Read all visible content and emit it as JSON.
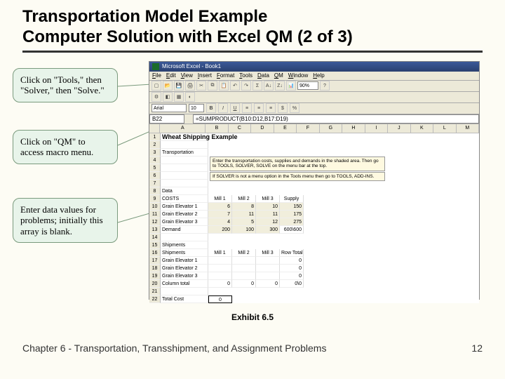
{
  "slide": {
    "title_line1": "Transportation Model Example",
    "title_line2": "Computer Solution with Excel QM (2 of 3)",
    "caption": "Exhibit 6.5",
    "footer_left": "Chapter 6 - Transportation, Transshipment, and Assignment Problems",
    "footer_right": "12"
  },
  "callouts": [
    {
      "text": "Click on \"Tools,\" then \"Solver,\" then \"Solve.\""
    },
    {
      "text": "Click on \"QM\" to access macro menu."
    },
    {
      "text": "Enter data values for problems; initially this array is blank."
    }
  ],
  "excel": {
    "titlebar": "Microsoft Excel - Book1",
    "menus": [
      "File",
      "Edit",
      "View",
      "Insert",
      "Format",
      "Tools",
      "Data",
      "QM",
      "Window",
      "Help"
    ],
    "toolbar2": {
      "font": "Arial",
      "size": "10",
      "zoom": "90%"
    },
    "name_box": "B22",
    "formula": "=SUMPRODUCT(B10:D12,B17:D19)",
    "columns": [
      "",
      "A",
      "B",
      "C",
      "D",
      "E",
      "F",
      "G",
      "H",
      "I",
      "J",
      "K",
      "L",
      "M"
    ],
    "sheet_title": "Wheat Shipping Example",
    "section_transport": "Transportation",
    "instruction1": "Enter the transportation costs, supplies and demands in the shaded area. Then go to TOOLS, SOLVER, SOLVE on the menu bar at the top.",
    "instruction2": "If SOLVER is not a menu option in the Tools menu then go to TOOLS, ADD-INS.",
    "rows": {
      "r8": [
        "Data",
        "",
        "",
        "",
        "",
        "",
        "",
        "",
        "",
        "",
        "",
        "",
        ""
      ],
      "r9": [
        "COSTS",
        "Mill 1",
        "Mill 2",
        "Mill 3",
        "Supply",
        "",
        "",
        "",
        "",
        "",
        "",
        "",
        ""
      ],
      "r10": [
        "Grain Elevator 1",
        "6",
        "8",
        "10",
        "150",
        "",
        "",
        "",
        "",
        "",
        "",
        "",
        ""
      ],
      "r11": [
        "Grain Elevator 2",
        "7",
        "11",
        "11",
        "175",
        "",
        "",
        "",
        "",
        "",
        "",
        "",
        ""
      ],
      "r12": [
        "Grain Elevator 3",
        "4",
        "5",
        "12",
        "275",
        "",
        "",
        "",
        "",
        "",
        "",
        "",
        ""
      ],
      "r13": [
        "Demand",
        "200",
        "100",
        "300",
        "600\\600",
        "",
        "",
        "",
        "",
        "",
        "",
        "",
        ""
      ],
      "r15": [
        "Shipments",
        "",
        "",
        "",
        "",
        "",
        "",
        "",
        "",
        "",
        "",
        "",
        ""
      ],
      "r16": [
        "Shipments",
        "Mill 1",
        "Mill 2",
        "Mill 3",
        "Row Total",
        "",
        "",
        "",
        "",
        "",
        "",
        "",
        ""
      ],
      "r17": [
        "Grain Elevator 1",
        "",
        "",
        "",
        "0",
        "",
        "",
        "",
        "",
        "",
        "",
        "",
        ""
      ],
      "r18": [
        "Grain Elevator 2",
        "",
        "",
        "",
        "0",
        "",
        "",
        "",
        "",
        "",
        "",
        "",
        ""
      ],
      "r19": [
        "Grain Elevator 3",
        "",
        "",
        "",
        "0",
        "",
        "",
        "",
        "",
        "",
        "",
        "",
        ""
      ],
      "r20": [
        "Column total",
        "0",
        "0",
        "0",
        "0\\0",
        "",
        "",
        "",
        "",
        "",
        "",
        "",
        ""
      ],
      "r22": [
        "Total Cost",
        "0",
        "",
        "",
        "",
        "",
        "",
        "",
        "",
        "",
        "",
        "",
        ""
      ]
    }
  }
}
